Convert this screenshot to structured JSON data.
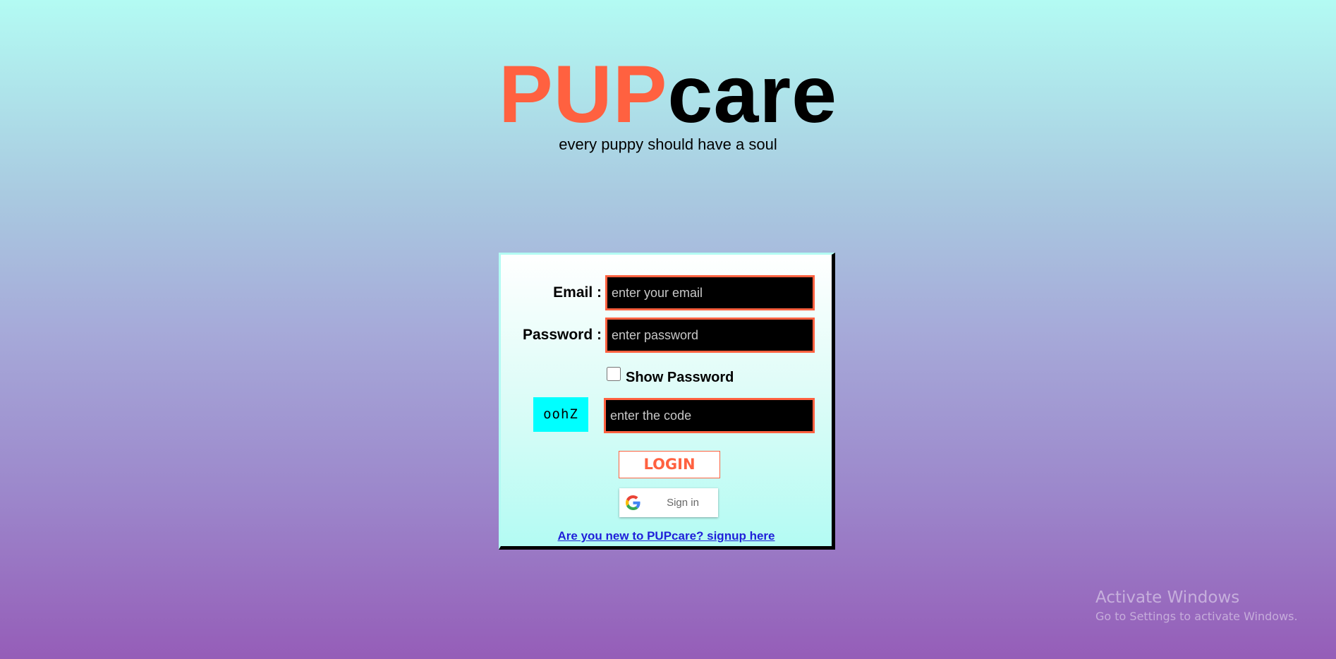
{
  "header": {
    "logo_part1": "PUP",
    "logo_part2": "care",
    "tagline": "every puppy should have a soul"
  },
  "login_form": {
    "email_label": "Email :",
    "email_placeholder": "enter your email",
    "email_value": "",
    "password_label": "Password :",
    "password_placeholder": "enter password",
    "password_value": "",
    "show_password_label": "Show Password",
    "show_password_checked": false,
    "captcha_code": "oohZ",
    "code_placeholder": "enter the code",
    "code_value": "",
    "login_label": "LOGIN",
    "google_signin_label": "Sign in",
    "signup_link": "Are you new to PUPcare? signup here"
  },
  "watermark": {
    "title": "Activate Windows",
    "subtitle": "Go to Settings to activate Windows."
  },
  "colors": {
    "accent": "#ff6140",
    "captcha_bg": "#00ffff",
    "link": "#1f1fd9"
  },
  "icons": {
    "google": "google-g-icon"
  }
}
